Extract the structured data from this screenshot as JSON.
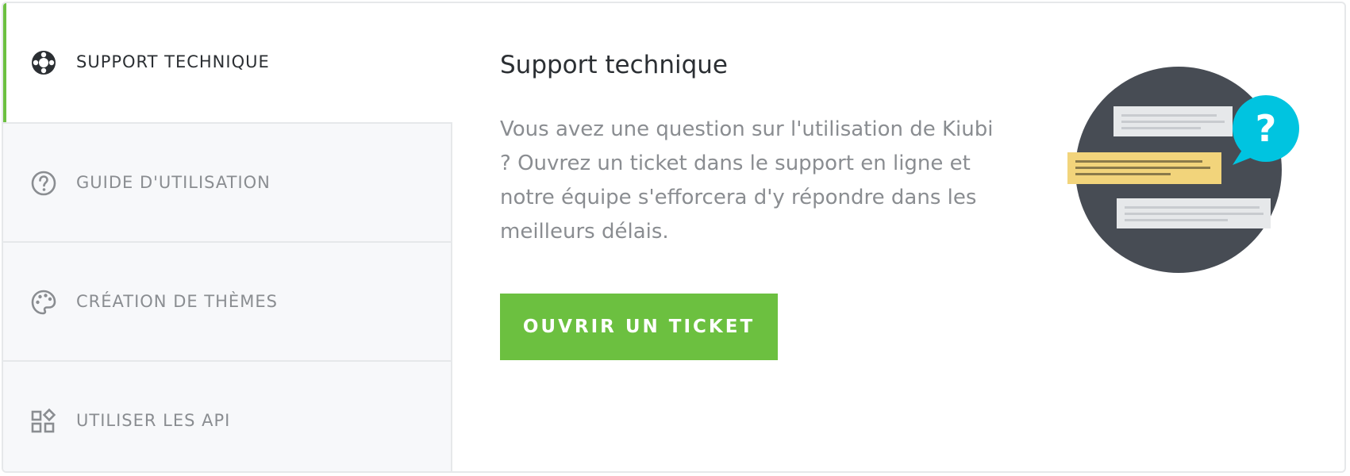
{
  "tabs": [
    {
      "label": "SUPPORT TECHNIQUE",
      "icon": "lifebuoy-icon",
      "active": true
    },
    {
      "label": "GUIDE D'UTILISATION",
      "icon": "question-circle-icon",
      "active": false
    },
    {
      "label": "CRÉATION DE THÈMES",
      "icon": "palette-icon",
      "active": false
    },
    {
      "label": "UTILISER LES API",
      "icon": "widgets-icon",
      "active": false
    }
  ],
  "panel": {
    "title": "Support technique",
    "description": "Vous avez une question sur l'utilisation de Kiubi ? Ouvrez un ticket dans le support en ligne et notre équipe s'efforcera d'y répondre dans les meilleurs délais.",
    "button_label": "OUVRIR UN TICKET"
  },
  "colors": {
    "accent": "#6cc040",
    "bubble_blue": "#00c4e0",
    "bubble_yellow": "#f2d47b",
    "illustration_bg": "#474c54"
  }
}
